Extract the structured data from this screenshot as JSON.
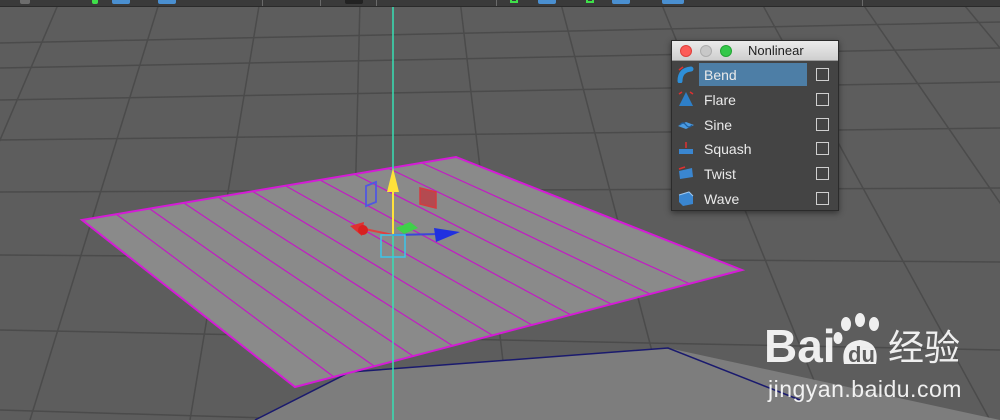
{
  "panel": {
    "title": "Nonlinear",
    "items": [
      {
        "label": "Bend",
        "icon": "bend-deformer-icon",
        "selected": true,
        "checked": false
      },
      {
        "label": "Flare",
        "icon": "flare-deformer-icon",
        "selected": false,
        "checked": false
      },
      {
        "label": "Sine",
        "icon": "sine-deformer-icon",
        "selected": false,
        "checked": false
      },
      {
        "label": "Squash",
        "icon": "squash-deformer-icon",
        "selected": false,
        "checked": false
      },
      {
        "label": "Twist",
        "icon": "twist-deformer-icon",
        "selected": false,
        "checked": false
      },
      {
        "label": "Wave",
        "icon": "wave-deformer-icon",
        "selected": false,
        "checked": false
      }
    ]
  },
  "watermark": {
    "brand": "Bai",
    "brand_suffix": "du",
    "cn_text": "经验",
    "url": "jingyan.baidu.com"
  },
  "colors": {
    "viewport_bg": "#5d5d5d",
    "grid": "#4b4b4b",
    "plane_fill": "#8a8a8a",
    "plane_outline": "#d41bd6",
    "y_axis": "#37e0b4",
    "selection_highlight": "#4d7ea6"
  }
}
